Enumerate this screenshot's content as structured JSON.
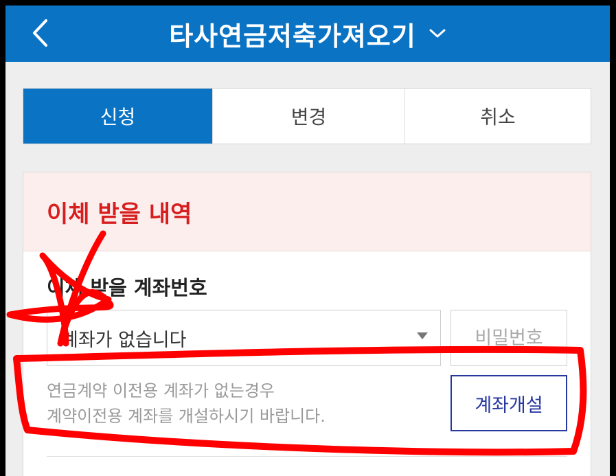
{
  "header": {
    "title": "타사연금저축가져오기",
    "back_icon": "chevron-left-icon",
    "dropdown_icon": "chevron-down-icon"
  },
  "tabs": [
    {
      "label": "신청",
      "active": true
    },
    {
      "label": "변경",
      "active": false
    },
    {
      "label": "취소",
      "active": false
    }
  ],
  "section": {
    "title": "이체 받을 내역",
    "field_label": "이체 받을 계좌번호",
    "account_select": {
      "value": "계좌가 없습니다"
    },
    "password": {
      "placeholder": "비밀번호"
    },
    "notice_line1": "연금계약 이전용 계좌가 없는경우",
    "notice_line2": "계약이전용 계좌를 개설하시기 바랍니다.",
    "open_button_label": "계좌개설"
  },
  "colors": {
    "header_bg": "#0a73c4",
    "tab_active": "#0a73c4",
    "section_title": "#d71e1e",
    "section_head_bg": "#fdeeee",
    "button_border": "#27389e",
    "annotation": "#ff0000"
  }
}
